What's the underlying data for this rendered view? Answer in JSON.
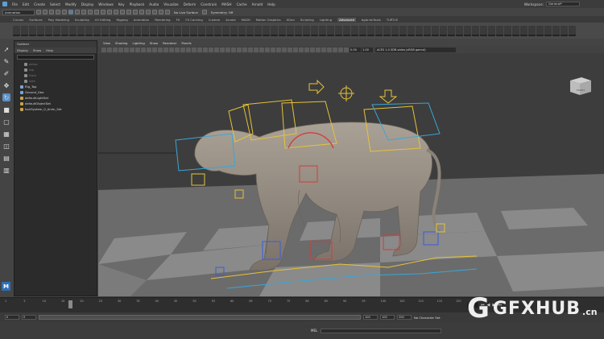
{
  "menubar": {
    "items": [
      "File",
      "Edit",
      "Create",
      "Select",
      "Modify",
      "Display",
      "Windows",
      "Key",
      "Playback",
      "Audio",
      "Visualize",
      "Deform",
      "Constrain",
      "MASH",
      "Cache",
      "Arnold",
      "Help"
    ],
    "workspace_label": "Workspace:",
    "workspace_value": "General*"
  },
  "statusline": {
    "menuset": "Animation",
    "no_live_surface": "No Live Surface",
    "symmetry": "Symmetry: Off"
  },
  "shelf_tabs": [
    "Curves",
    "Surfaces",
    "Poly Modeling",
    "Sculpting",
    "UV Editing",
    "Rigging",
    "Animation",
    "Rendering",
    "FX",
    "FX Caching",
    "Custom",
    "Arnold",
    "MASH",
    "Motion Graphics",
    "XGen",
    "Scripting",
    "Lighting",
    "Advanced",
    "bgAnimTools",
    "TURTLE"
  ],
  "active_shelf_tab": "Advanced",
  "outliner": {
    "title": "Outliner",
    "menu": [
      "Display",
      "Show",
      "Help"
    ],
    "items": [
      {
        "label": "persp",
        "kind": "cam",
        "dim": true
      },
      {
        "label": "top",
        "kind": "cam",
        "dim": true
      },
      {
        "label": "front",
        "kind": "cam",
        "dim": true
      },
      {
        "label": "side",
        "kind": "cam",
        "dim": true
      },
      {
        "label": "Rig_Top",
        "kind": "xf",
        "dim": false
      },
      {
        "label": "Ground_Geo",
        "kind": "xf",
        "dim": false
      },
      {
        "label": "defaultLightSet",
        "kind": "set",
        "dim": false
      },
      {
        "label": "defaultObjectSet",
        "kind": "set",
        "dim": false
      },
      {
        "label": "hairSystem_0_Anim_Set",
        "kind": "set",
        "dim": false
      }
    ]
  },
  "viewport": {
    "menu": [
      "View",
      "Shading",
      "Lighting",
      "Show",
      "Renderer",
      "Panels"
    ],
    "value_a": "0.00",
    "value_b": "1.00",
    "color_space": "ACES 1.0 SDR-video (sRGB gamut)",
    "view_cube_label": "FRONT"
  },
  "timeslider": {
    "ticks": [
      "1",
      "5",
      "10",
      "15",
      "20",
      "25",
      "30",
      "35",
      "40",
      "45",
      "50",
      "55",
      "60",
      "65",
      "70",
      "75",
      "80",
      "85",
      "90",
      "95",
      "100",
      "105",
      "110",
      "115",
      "120"
    ],
    "current_frame": "15"
  },
  "rangeslider": {
    "start": "0",
    "start_inner": "0",
    "end_inner": "100",
    "end": "100",
    "end_outer": "200",
    "character_set": "No Character Set"
  },
  "cmdline": {
    "label": "MEL"
  },
  "watermark": {
    "glyph": "G",
    "text": "GFXHUB",
    "suffix": ".cn"
  },
  "colors": {
    "accent": "#5a8fc4",
    "creature": "#9c9389",
    "rig_yellow": "#e6c23a",
    "rig_red": "#d83a3a",
    "rig_blue": "#3a5adf",
    "rig_cyan": "#3aa6d8"
  }
}
